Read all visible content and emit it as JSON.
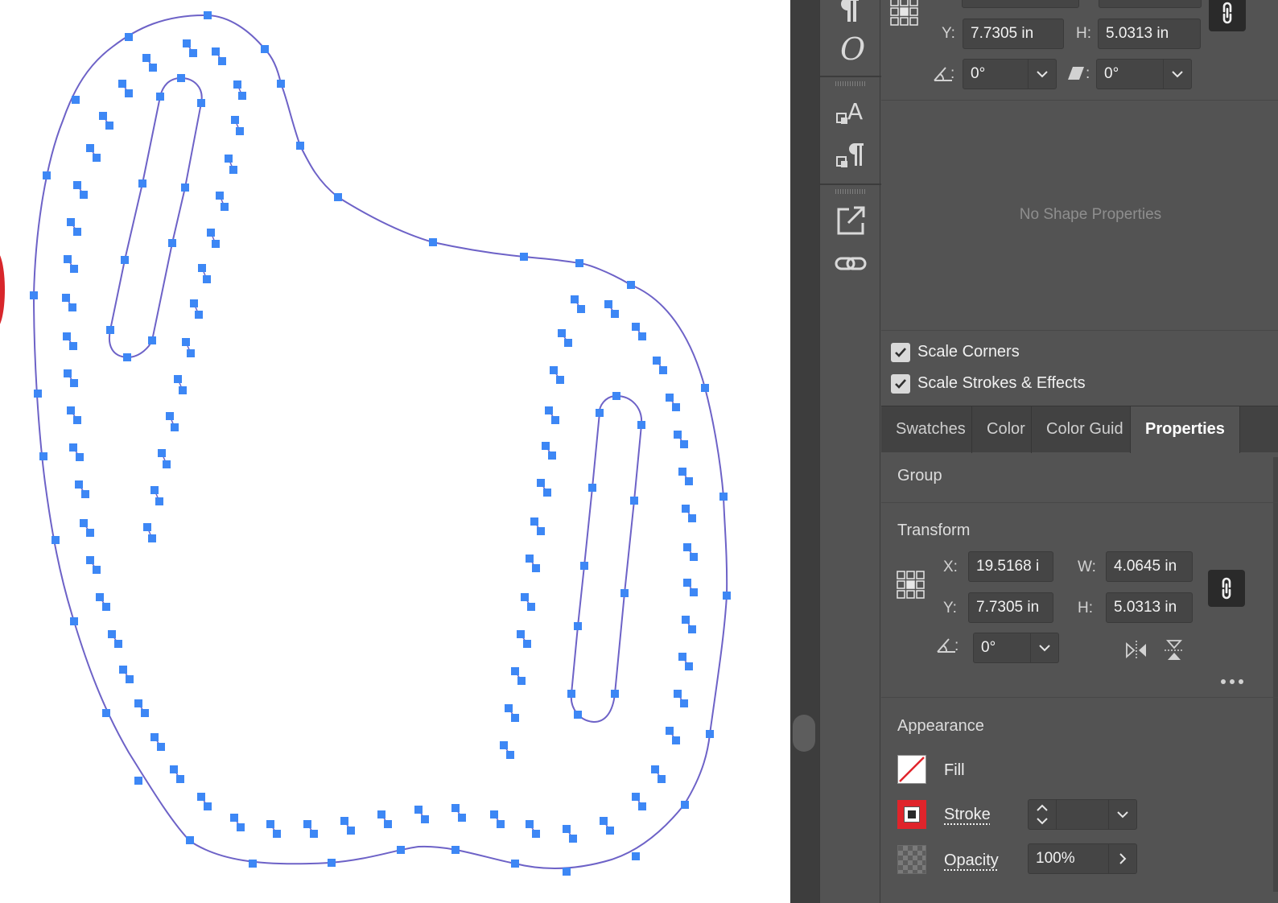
{
  "canvas": {
    "selection_color": "#3d87f5",
    "path_color": "#6d62c7"
  },
  "top_transform": {
    "y_label": "Y:",
    "y_value": "7.7305 in",
    "h_label": "H:",
    "h_value": "5.0313 in",
    "rotate_value": "0°",
    "shear_value": "0°"
  },
  "shape_properties": {
    "empty_text": "No Shape Properties"
  },
  "options": {
    "scale_corners": {
      "label": "Scale Corners",
      "checked": true
    },
    "scale_strokes": {
      "label": "Scale Strokes & Effects",
      "checked": true
    }
  },
  "tabs": [
    {
      "label": "Swatches",
      "active": false
    },
    {
      "label": "Color",
      "active": false
    },
    {
      "label": "Color Guid",
      "active": false
    },
    {
      "label": "Properties",
      "active": true
    }
  ],
  "properties": {
    "selection_type": "Group",
    "transform": {
      "title": "Transform",
      "x_label": "X:",
      "x_value": "19.5168 i",
      "w_label": "W:",
      "w_value": "4.0645 in",
      "y_label": "Y:",
      "y_value": "7.7305 in",
      "h_label": "H:",
      "h_value": "5.0313 in",
      "rotate_value": "0°"
    },
    "appearance": {
      "title": "Appearance",
      "fill_label": "Fill",
      "stroke_label": "Stroke",
      "stroke_value": "",
      "opacity_label": "Opacity",
      "opacity_value": "100%"
    }
  },
  "icons": {
    "toolstrip": [
      "paragraph-icon",
      "opentype-icon",
      "character-styles-icon",
      "paragraph-styles-icon",
      "export-icon",
      "links-icon"
    ],
    "panel": [
      "reference-point-icon",
      "link-proportions-icon",
      "rotate-icon",
      "shear-icon",
      "flip-horizontal-icon",
      "flip-vertical-icon",
      "more-options-icon",
      "chevron-down-icon",
      "chevron-right-icon",
      "stepper-icon",
      "checkmark-icon"
    ]
  }
}
